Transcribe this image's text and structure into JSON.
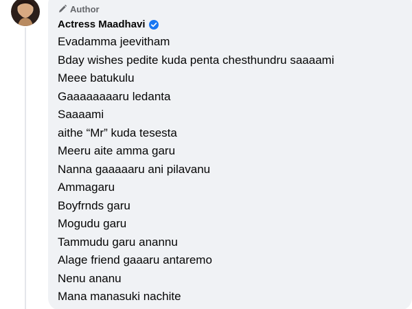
{
  "comment": {
    "badge_label": "Author",
    "author_name": "Actress Maadhavi",
    "lines": [
      "Evadamma jeevitham",
      "Bday wishes pedite kuda penta chesthundru saaaami",
      "Meee batukulu",
      "Gaaaaaaaaru ledanta",
      "Saaaami",
      "aithe “Mr” kuda tesesta",
      "Meeru aite amma garu",
      "Nanna gaaaaaru ani pilavanu",
      "Ammagaru",
      "Boyfrnds garu",
      "Mogudu garu",
      "Tammudu garu anannu",
      "Alage friend gaaaru antaremo",
      "Nenu ananu",
      "Mana manasuki nachite"
    ]
  },
  "colors": {
    "bubble": "#f0f2f5",
    "verified": "#1877f2",
    "muted_text": "#65676b"
  },
  "icons": {
    "badge": "pencil-icon",
    "verified": "verified-badge-icon"
  }
}
